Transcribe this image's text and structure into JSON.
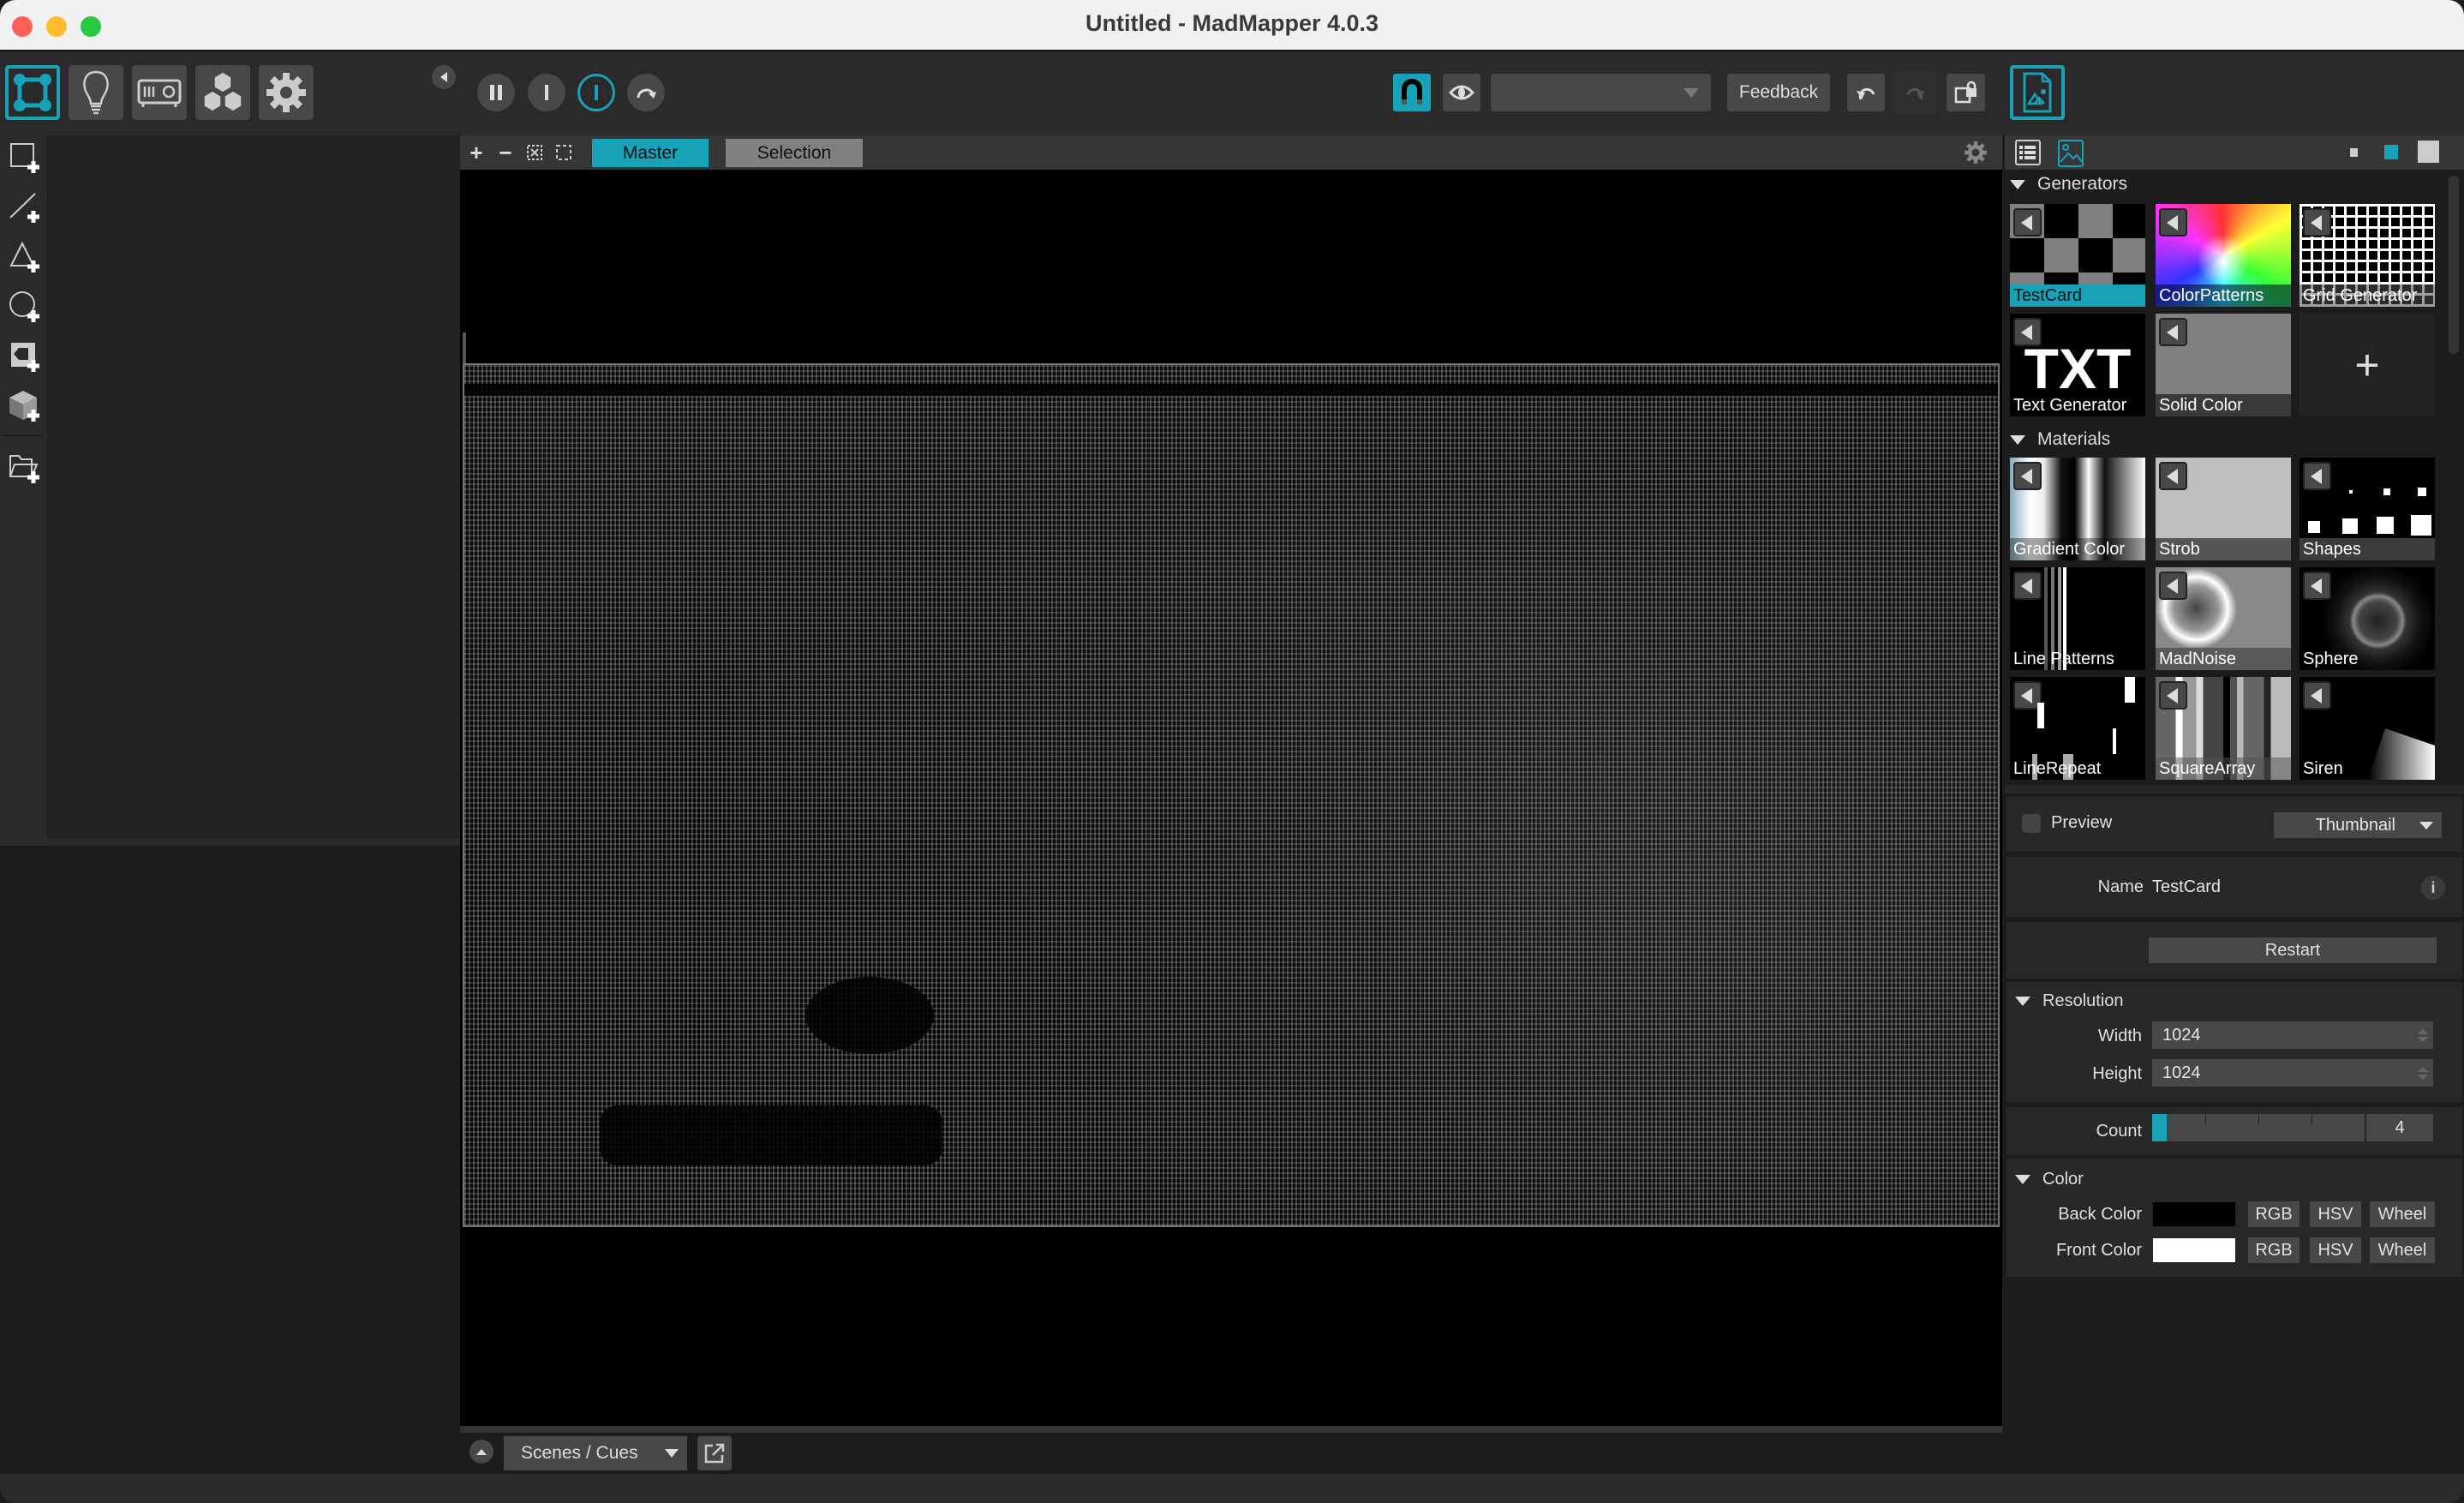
{
  "window": {
    "title": "Untitled - MadMapper 4.0.3",
    "traffic_lights": [
      {
        "name": "close",
        "color": "#fe5f57"
      },
      {
        "name": "minimize",
        "color": "#febc2e"
      },
      {
        "name": "zoom",
        "color": "#28c840"
      }
    ]
  },
  "colors": {
    "accent": "#17a2b8",
    "panel_bg": "#282828",
    "toolbar_bg": "#2a2a2a",
    "button_bg": "#484848"
  },
  "toolbar": {
    "modes": [
      {
        "id": "surfaces",
        "icon": "surface-quad-icon",
        "active": true
      },
      {
        "id": "lights",
        "icon": "lightbulb-icon",
        "active": false
      },
      {
        "id": "outputs",
        "icon": "projector-icon",
        "active": false
      },
      {
        "id": "modules",
        "icon": "cubes-icon",
        "active": false
      },
      {
        "id": "settings",
        "icon": "gear-icon",
        "active": false
      }
    ],
    "transport": [
      {
        "id": "pause",
        "icon": "pause-icon"
      },
      {
        "id": "stop",
        "icon": "stop-bar-icon"
      },
      {
        "id": "play",
        "icon": "play-bar-icon",
        "active": true
      },
      {
        "id": "loop",
        "icon": "loop-arrow-icon"
      }
    ],
    "snap_active": true,
    "output_dropdown_value": "",
    "feedback_label": "Feedback",
    "undo_enabled": true,
    "redo_enabled": false
  },
  "left_tools": [
    {
      "id": "add-quad",
      "icon": "add-quad-icon"
    },
    {
      "id": "add-line",
      "icon": "add-line-icon"
    },
    {
      "id": "add-triangle",
      "icon": "add-triangle-icon"
    },
    {
      "id": "add-circle",
      "icon": "add-circle-icon"
    },
    {
      "id": "add-mask",
      "icon": "add-mask-icon"
    },
    {
      "id": "add-3d-object",
      "icon": "add-cube-icon"
    },
    {
      "id": "add-group",
      "icon": "add-folder-icon"
    }
  ],
  "canvas": {
    "tools": [
      "zoom-in",
      "zoom-out",
      "fit",
      "select-area"
    ],
    "tabs": [
      {
        "label": "Master",
        "active": true
      },
      {
        "label": "Selection",
        "active": false
      }
    ]
  },
  "bottom": {
    "panel_select": "Scenes / Cues"
  },
  "library": {
    "view_modes": [
      "list",
      "thumbnails"
    ],
    "active_view": "thumbnails",
    "thumb_sizes": [
      "small",
      "medium",
      "large"
    ],
    "active_size": "medium",
    "sections": [
      {
        "title": "Generators",
        "items": [
          {
            "label": "TestCard",
            "selected": true
          },
          {
            "label": "ColorPatterns"
          },
          {
            "label": "Grid Generator"
          },
          {
            "label": "Text Generator"
          },
          {
            "label": "Solid Color"
          }
        ],
        "add_label": "+"
      },
      {
        "title": "Materials",
        "items": [
          {
            "label": "Gradient Color"
          },
          {
            "label": "Strob"
          },
          {
            "label": "Shapes"
          },
          {
            "label": "Line Patterns"
          },
          {
            "label": "MadNoise"
          },
          {
            "label": "Sphere"
          },
          {
            "label": "LineRepeat"
          },
          {
            "label": "SquareArray"
          },
          {
            "label": "Siren"
          }
        ]
      }
    ],
    "txt_thumb_text": "TXT"
  },
  "properties": {
    "preview_label": "Preview",
    "preview_checked": false,
    "preview_mode": "Thumbnail",
    "name_label": "Name",
    "name_value": "TestCard",
    "info_label": "i",
    "restart_label": "Restart",
    "resolution": {
      "title": "Resolution",
      "width_label": "Width",
      "width_value": "1024",
      "height_label": "Height",
      "height_value": "1024"
    },
    "count": {
      "label": "Count",
      "value": "4",
      "fill_fraction": 0.07
    },
    "color": {
      "title": "Color",
      "back_label": "Back Color",
      "back_value": "#000000",
      "front_label": "Front Color",
      "front_value": "#ffffff",
      "mode_buttons": [
        "RGB",
        "HSV",
        "Wheel"
      ]
    }
  }
}
